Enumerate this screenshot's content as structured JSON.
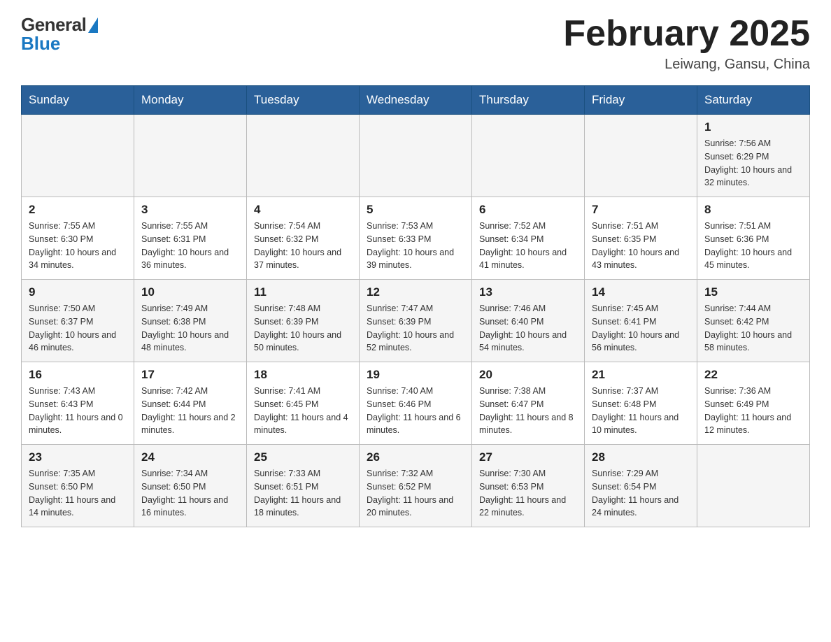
{
  "header": {
    "logo_general": "General",
    "logo_blue": "Blue",
    "month_title": "February 2025",
    "location": "Leiwang, Gansu, China"
  },
  "weekdays": [
    "Sunday",
    "Monday",
    "Tuesday",
    "Wednesday",
    "Thursday",
    "Friday",
    "Saturday"
  ],
  "weeks": [
    [
      {
        "day": "",
        "info": ""
      },
      {
        "day": "",
        "info": ""
      },
      {
        "day": "",
        "info": ""
      },
      {
        "day": "",
        "info": ""
      },
      {
        "day": "",
        "info": ""
      },
      {
        "day": "",
        "info": ""
      },
      {
        "day": "1",
        "info": "Sunrise: 7:56 AM\nSunset: 6:29 PM\nDaylight: 10 hours\nand 32 minutes."
      }
    ],
    [
      {
        "day": "2",
        "info": "Sunrise: 7:55 AM\nSunset: 6:30 PM\nDaylight: 10 hours\nand 34 minutes."
      },
      {
        "day": "3",
        "info": "Sunrise: 7:55 AM\nSunset: 6:31 PM\nDaylight: 10 hours\nand 36 minutes."
      },
      {
        "day": "4",
        "info": "Sunrise: 7:54 AM\nSunset: 6:32 PM\nDaylight: 10 hours\nand 37 minutes."
      },
      {
        "day": "5",
        "info": "Sunrise: 7:53 AM\nSunset: 6:33 PM\nDaylight: 10 hours\nand 39 minutes."
      },
      {
        "day": "6",
        "info": "Sunrise: 7:52 AM\nSunset: 6:34 PM\nDaylight: 10 hours\nand 41 minutes."
      },
      {
        "day": "7",
        "info": "Sunrise: 7:51 AM\nSunset: 6:35 PM\nDaylight: 10 hours\nand 43 minutes."
      },
      {
        "day": "8",
        "info": "Sunrise: 7:51 AM\nSunset: 6:36 PM\nDaylight: 10 hours\nand 45 minutes."
      }
    ],
    [
      {
        "day": "9",
        "info": "Sunrise: 7:50 AM\nSunset: 6:37 PM\nDaylight: 10 hours\nand 46 minutes."
      },
      {
        "day": "10",
        "info": "Sunrise: 7:49 AM\nSunset: 6:38 PM\nDaylight: 10 hours\nand 48 minutes."
      },
      {
        "day": "11",
        "info": "Sunrise: 7:48 AM\nSunset: 6:39 PM\nDaylight: 10 hours\nand 50 minutes."
      },
      {
        "day": "12",
        "info": "Sunrise: 7:47 AM\nSunset: 6:39 PM\nDaylight: 10 hours\nand 52 minutes."
      },
      {
        "day": "13",
        "info": "Sunrise: 7:46 AM\nSunset: 6:40 PM\nDaylight: 10 hours\nand 54 minutes."
      },
      {
        "day": "14",
        "info": "Sunrise: 7:45 AM\nSunset: 6:41 PM\nDaylight: 10 hours\nand 56 minutes."
      },
      {
        "day": "15",
        "info": "Sunrise: 7:44 AM\nSunset: 6:42 PM\nDaylight: 10 hours\nand 58 minutes."
      }
    ],
    [
      {
        "day": "16",
        "info": "Sunrise: 7:43 AM\nSunset: 6:43 PM\nDaylight: 11 hours\nand 0 minutes."
      },
      {
        "day": "17",
        "info": "Sunrise: 7:42 AM\nSunset: 6:44 PM\nDaylight: 11 hours\nand 2 minutes."
      },
      {
        "day": "18",
        "info": "Sunrise: 7:41 AM\nSunset: 6:45 PM\nDaylight: 11 hours\nand 4 minutes."
      },
      {
        "day": "19",
        "info": "Sunrise: 7:40 AM\nSunset: 6:46 PM\nDaylight: 11 hours\nand 6 minutes."
      },
      {
        "day": "20",
        "info": "Sunrise: 7:38 AM\nSunset: 6:47 PM\nDaylight: 11 hours\nand 8 minutes."
      },
      {
        "day": "21",
        "info": "Sunrise: 7:37 AM\nSunset: 6:48 PM\nDaylight: 11 hours\nand 10 minutes."
      },
      {
        "day": "22",
        "info": "Sunrise: 7:36 AM\nSunset: 6:49 PM\nDaylight: 11 hours\nand 12 minutes."
      }
    ],
    [
      {
        "day": "23",
        "info": "Sunrise: 7:35 AM\nSunset: 6:50 PM\nDaylight: 11 hours\nand 14 minutes."
      },
      {
        "day": "24",
        "info": "Sunrise: 7:34 AM\nSunset: 6:50 PM\nDaylight: 11 hours\nand 16 minutes."
      },
      {
        "day": "25",
        "info": "Sunrise: 7:33 AM\nSunset: 6:51 PM\nDaylight: 11 hours\nand 18 minutes."
      },
      {
        "day": "26",
        "info": "Sunrise: 7:32 AM\nSunset: 6:52 PM\nDaylight: 11 hours\nand 20 minutes."
      },
      {
        "day": "27",
        "info": "Sunrise: 7:30 AM\nSunset: 6:53 PM\nDaylight: 11 hours\nand 22 minutes."
      },
      {
        "day": "28",
        "info": "Sunrise: 7:29 AM\nSunset: 6:54 PM\nDaylight: 11 hours\nand 24 minutes."
      },
      {
        "day": "",
        "info": ""
      }
    ]
  ]
}
